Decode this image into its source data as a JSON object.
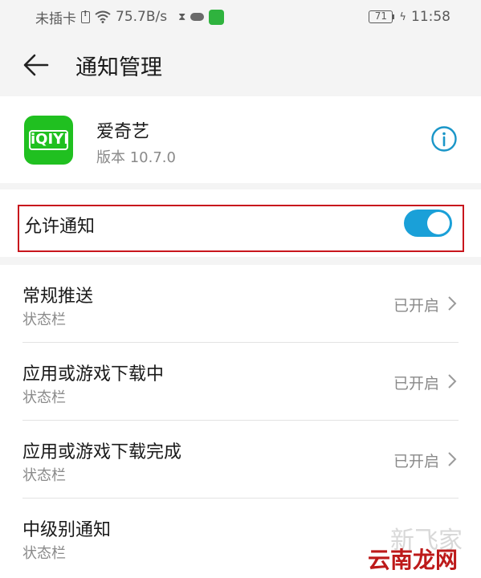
{
  "status_bar": {
    "sim_text": "未插卡",
    "net_speed": "75.7B/s",
    "battery": "71",
    "time": "11:58",
    "icons": [
      "sim-icon",
      "wifi-icon",
      "hourglass-icon",
      "cloud-icon",
      "wechat-icon",
      "battery-icon",
      "bolt-icon"
    ]
  },
  "header": {
    "title": "通知管理",
    "back_icon": "arrow-left-icon"
  },
  "app": {
    "name": "爱奇艺",
    "version": "版本 10.7.0",
    "icon_text": "iQIYI",
    "info_icon": "info-icon",
    "icon_color": "#20c020"
  },
  "allow_notification": {
    "label": "允许通知",
    "enabled": true,
    "toggle_color": "#1aa0d8",
    "highlight_color": "#c8161d"
  },
  "channels": [
    {
      "title": "常规推送",
      "subtitle": "状态栏",
      "status": "已开启"
    },
    {
      "title": "应用或游戏下载中",
      "subtitle": "状态栏",
      "status": "已开启"
    },
    {
      "title": "应用或游戏下载完成",
      "subtitle": "状态栏",
      "status": "已开启"
    },
    {
      "title": "中级别通知",
      "subtitle": "状态栏",
      "status": ""
    }
  ],
  "watermark": {
    "top": "新飞家",
    "bottom": "云南龙网"
  }
}
